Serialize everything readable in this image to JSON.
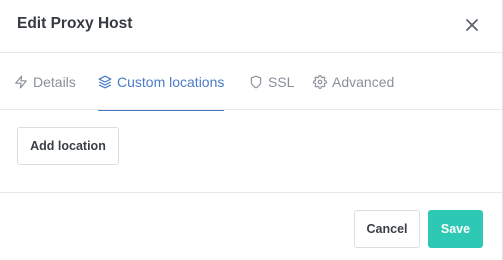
{
  "modal": {
    "title": "Edit Proxy Host",
    "close_icon": "close-icon"
  },
  "tabs": [
    {
      "label": "Details",
      "icon": "lightning-icon",
      "active": false
    },
    {
      "label": "Custom locations",
      "icon": "layers-icon",
      "active": true
    },
    {
      "label": "SSL",
      "icon": "shield-icon",
      "active": false
    },
    {
      "label": "Advanced",
      "icon": "gear-icon",
      "active": false
    }
  ],
  "body": {
    "add_location_label": "Add location"
  },
  "footer": {
    "cancel_label": "Cancel",
    "save_label": "Save"
  },
  "colors": {
    "accent": "#4a7cc4",
    "save": "#2ec9b4"
  }
}
